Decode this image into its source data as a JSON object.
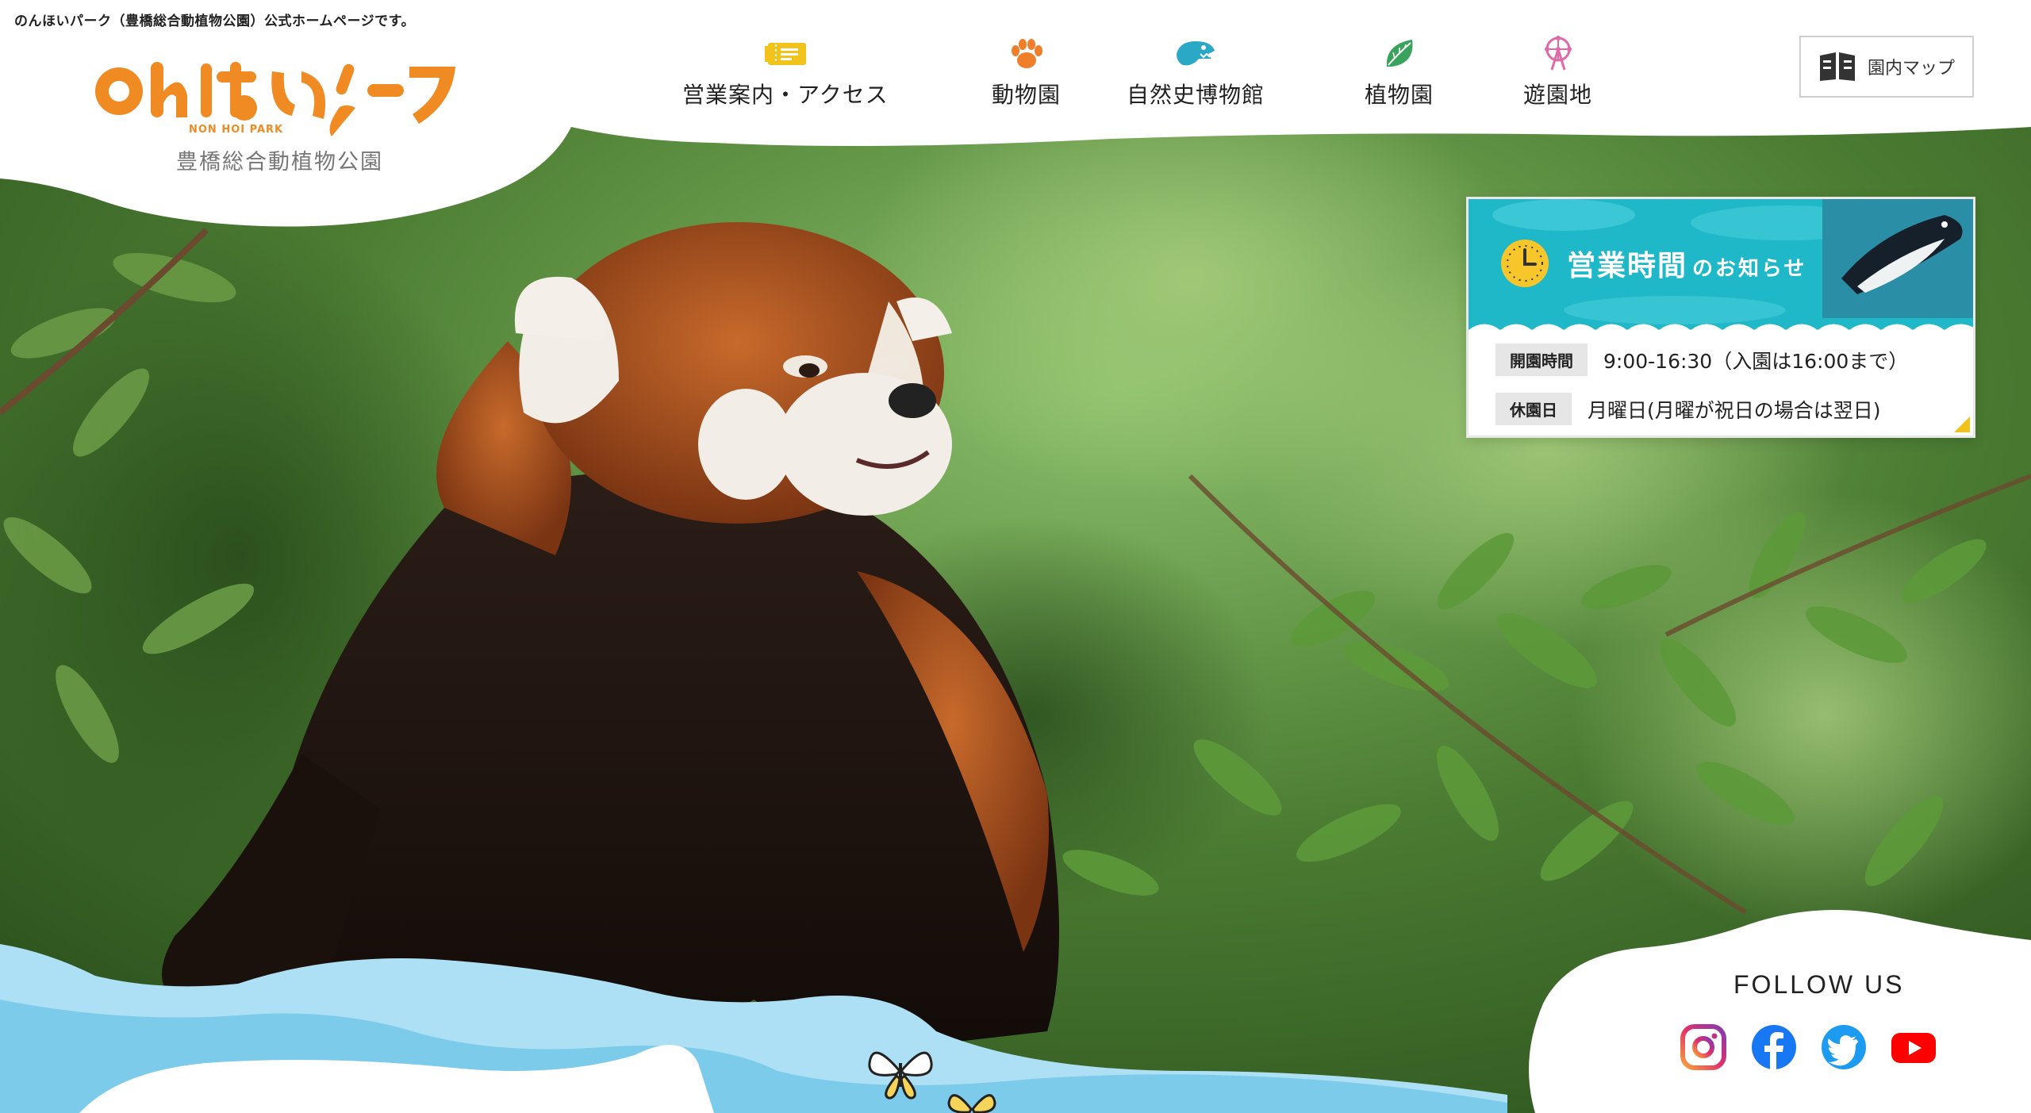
{
  "header": {
    "caption": "のんほいパーク（豊橋総合動植物公園）公式ホームページです。",
    "logo_main": "のんほいパーク",
    "logo_en": "NON HOI PARK",
    "logo_sub": "豊橋総合動植物公園"
  },
  "nav": {
    "items": [
      {
        "label": "営業案内・アクセス",
        "icon": "ticket-icon"
      },
      {
        "label": "動物園",
        "icon": "paw-icon"
      },
      {
        "label": "自然史博物館",
        "icon": "dinosaur-icon"
      },
      {
        "label": "植物園",
        "icon": "leaf-icon"
      },
      {
        "label": "遊園地",
        "icon": "ferris-wheel-icon"
      }
    ],
    "map_button": "園内マップ",
    "map_icon": "map-book-icon"
  },
  "info": {
    "title": "営業時間",
    "title_suffix": "のお知らせ",
    "rows": [
      {
        "tag": "開園時間",
        "value": "9:00-16:30（入園は16:00まで）"
      },
      {
        "tag": "休園日",
        "value": "月曜日(月曜が祝日の場合は翌日)"
      }
    ],
    "icon": "clock-icon",
    "image_icon": "penguin-icon"
  },
  "follow": {
    "title": "FOLLOW US",
    "links": [
      {
        "name": "instagram",
        "icon": "instagram-icon",
        "color": "#c13584"
      },
      {
        "name": "facebook",
        "icon": "facebook-icon",
        "color": "#1877f2"
      },
      {
        "name": "twitter",
        "icon": "twitter-icon",
        "color": "#1d9bf0"
      },
      {
        "name": "youtube",
        "icon": "youtube-icon",
        "color": "#ff0000"
      }
    ]
  },
  "colors": {
    "brand_orange": "#f08a23",
    "info_teal": "#1fb8c9",
    "wave_blue": "#aee0f5"
  }
}
